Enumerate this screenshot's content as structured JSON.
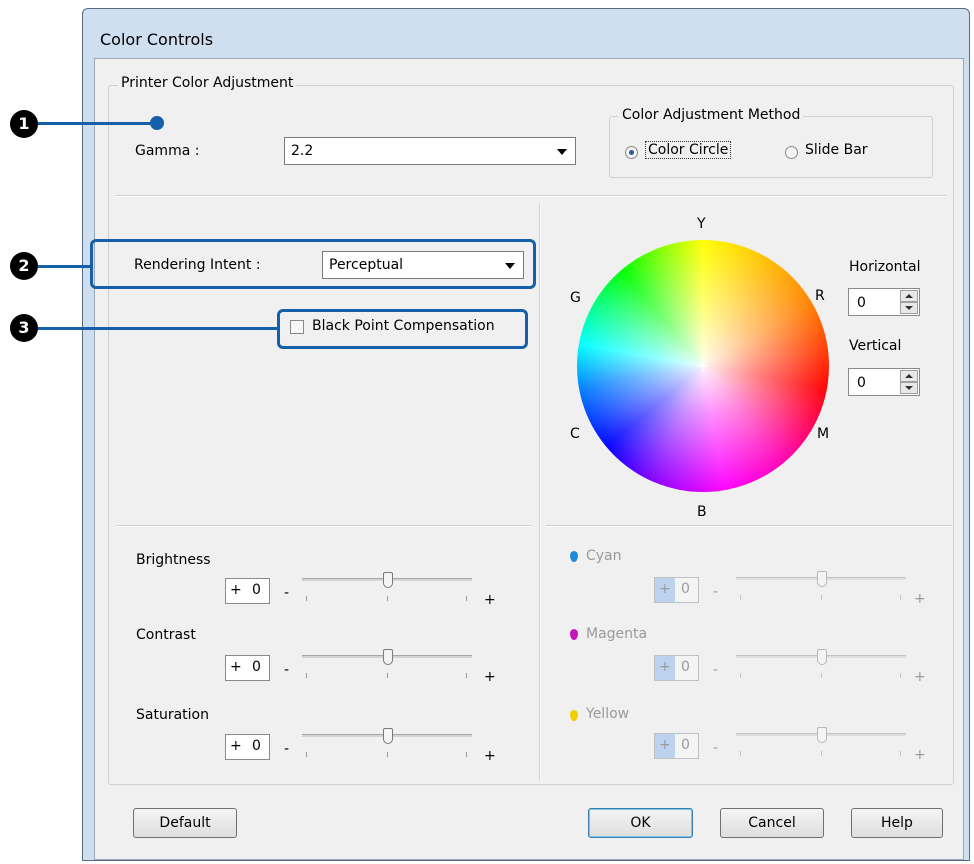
{
  "window": {
    "title": "Color Controls"
  },
  "group": {
    "title": "Printer Color Adjustment"
  },
  "gamma": {
    "label": "Gamma :",
    "value": "2.2"
  },
  "method": {
    "title": "Color Adjustment Method",
    "options": [
      {
        "label": "Color Circle",
        "selected": true
      },
      {
        "label": "Slide Bar",
        "selected": false
      }
    ]
  },
  "rendering": {
    "label": "Rendering Intent :",
    "value": "Perceptual"
  },
  "bpc": {
    "label": "Black Point Compensation",
    "checked": false
  },
  "wheel": {
    "labels": {
      "Y": "Y",
      "R": "R",
      "M": "M",
      "B": "B",
      "C": "C",
      "G": "G"
    },
    "center": "+"
  },
  "horizontal": {
    "label": "Horizontal",
    "value": "0"
  },
  "vertical": {
    "label": "Vertical",
    "value": "0"
  },
  "sliders": [
    {
      "label": "Brightness",
      "sign": "+",
      "value": "0",
      "min": "-",
      "max": "+"
    },
    {
      "label": "Contrast",
      "sign": "+",
      "value": "0",
      "min": "-",
      "max": "+"
    },
    {
      "label": "Saturation",
      "sign": "+",
      "value": "0",
      "min": "-",
      "max": "+"
    }
  ],
  "ink_sliders": [
    {
      "label": "Cyan",
      "sign": "+",
      "value": "0",
      "min": "-",
      "max": "+",
      "color": "#1e8bd8"
    },
    {
      "label": "Magenta",
      "sign": "+",
      "value": "0",
      "min": "-",
      "max": "+",
      "color": "#c418b8"
    },
    {
      "label": "Yellow",
      "sign": "+",
      "value": "0",
      "min": "-",
      "max": "+",
      "color": "#f0d000"
    }
  ],
  "callouts": [
    "1",
    "2",
    "3"
  ],
  "buttons": {
    "default": "Default",
    "ok": "OK",
    "cancel": "Cancel",
    "help": "Help"
  },
  "colors": {
    "accent": "#1560a8"
  }
}
